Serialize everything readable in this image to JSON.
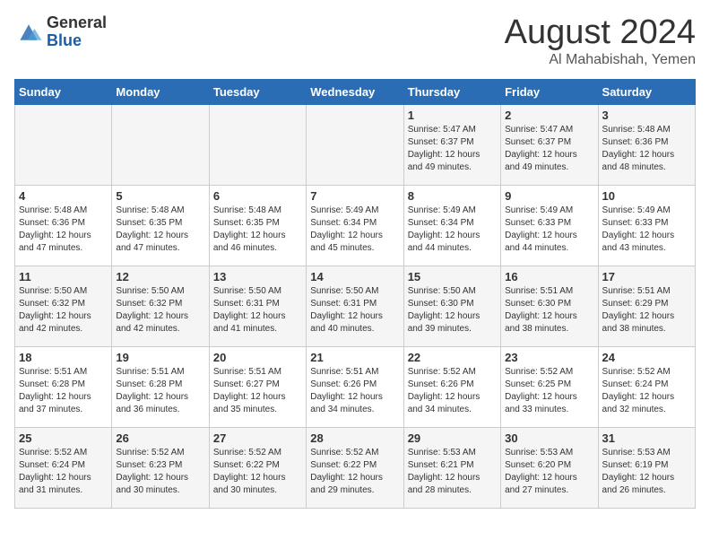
{
  "header": {
    "logo_general": "General",
    "logo_blue": "Blue",
    "main_title": "August 2024",
    "subtitle": "Al Mahabishah, Yemen"
  },
  "weekdays": [
    "Sunday",
    "Monday",
    "Tuesday",
    "Wednesday",
    "Thursday",
    "Friday",
    "Saturday"
  ],
  "weeks": [
    [
      {
        "day": "",
        "info": ""
      },
      {
        "day": "",
        "info": ""
      },
      {
        "day": "",
        "info": ""
      },
      {
        "day": "",
        "info": ""
      },
      {
        "day": "1",
        "info": "Sunrise: 5:47 AM\nSunset: 6:37 PM\nDaylight: 12 hours\nand 49 minutes."
      },
      {
        "day": "2",
        "info": "Sunrise: 5:47 AM\nSunset: 6:37 PM\nDaylight: 12 hours\nand 49 minutes."
      },
      {
        "day": "3",
        "info": "Sunrise: 5:48 AM\nSunset: 6:36 PM\nDaylight: 12 hours\nand 48 minutes."
      }
    ],
    [
      {
        "day": "4",
        "info": "Sunrise: 5:48 AM\nSunset: 6:36 PM\nDaylight: 12 hours\nand 47 minutes."
      },
      {
        "day": "5",
        "info": "Sunrise: 5:48 AM\nSunset: 6:35 PM\nDaylight: 12 hours\nand 47 minutes."
      },
      {
        "day": "6",
        "info": "Sunrise: 5:48 AM\nSunset: 6:35 PM\nDaylight: 12 hours\nand 46 minutes."
      },
      {
        "day": "7",
        "info": "Sunrise: 5:49 AM\nSunset: 6:34 PM\nDaylight: 12 hours\nand 45 minutes."
      },
      {
        "day": "8",
        "info": "Sunrise: 5:49 AM\nSunset: 6:34 PM\nDaylight: 12 hours\nand 44 minutes."
      },
      {
        "day": "9",
        "info": "Sunrise: 5:49 AM\nSunset: 6:33 PM\nDaylight: 12 hours\nand 44 minutes."
      },
      {
        "day": "10",
        "info": "Sunrise: 5:49 AM\nSunset: 6:33 PM\nDaylight: 12 hours\nand 43 minutes."
      }
    ],
    [
      {
        "day": "11",
        "info": "Sunrise: 5:50 AM\nSunset: 6:32 PM\nDaylight: 12 hours\nand 42 minutes."
      },
      {
        "day": "12",
        "info": "Sunrise: 5:50 AM\nSunset: 6:32 PM\nDaylight: 12 hours\nand 42 minutes."
      },
      {
        "day": "13",
        "info": "Sunrise: 5:50 AM\nSunset: 6:31 PM\nDaylight: 12 hours\nand 41 minutes."
      },
      {
        "day": "14",
        "info": "Sunrise: 5:50 AM\nSunset: 6:31 PM\nDaylight: 12 hours\nand 40 minutes."
      },
      {
        "day": "15",
        "info": "Sunrise: 5:50 AM\nSunset: 6:30 PM\nDaylight: 12 hours\nand 39 minutes."
      },
      {
        "day": "16",
        "info": "Sunrise: 5:51 AM\nSunset: 6:30 PM\nDaylight: 12 hours\nand 38 minutes."
      },
      {
        "day": "17",
        "info": "Sunrise: 5:51 AM\nSunset: 6:29 PM\nDaylight: 12 hours\nand 38 minutes."
      }
    ],
    [
      {
        "day": "18",
        "info": "Sunrise: 5:51 AM\nSunset: 6:28 PM\nDaylight: 12 hours\nand 37 minutes."
      },
      {
        "day": "19",
        "info": "Sunrise: 5:51 AM\nSunset: 6:28 PM\nDaylight: 12 hours\nand 36 minutes."
      },
      {
        "day": "20",
        "info": "Sunrise: 5:51 AM\nSunset: 6:27 PM\nDaylight: 12 hours\nand 35 minutes."
      },
      {
        "day": "21",
        "info": "Sunrise: 5:51 AM\nSunset: 6:26 PM\nDaylight: 12 hours\nand 34 minutes."
      },
      {
        "day": "22",
        "info": "Sunrise: 5:52 AM\nSunset: 6:26 PM\nDaylight: 12 hours\nand 34 minutes."
      },
      {
        "day": "23",
        "info": "Sunrise: 5:52 AM\nSunset: 6:25 PM\nDaylight: 12 hours\nand 33 minutes."
      },
      {
        "day": "24",
        "info": "Sunrise: 5:52 AM\nSunset: 6:24 PM\nDaylight: 12 hours\nand 32 minutes."
      }
    ],
    [
      {
        "day": "25",
        "info": "Sunrise: 5:52 AM\nSunset: 6:24 PM\nDaylight: 12 hours\nand 31 minutes."
      },
      {
        "day": "26",
        "info": "Sunrise: 5:52 AM\nSunset: 6:23 PM\nDaylight: 12 hours\nand 30 minutes."
      },
      {
        "day": "27",
        "info": "Sunrise: 5:52 AM\nSunset: 6:22 PM\nDaylight: 12 hours\nand 30 minutes."
      },
      {
        "day": "28",
        "info": "Sunrise: 5:52 AM\nSunset: 6:22 PM\nDaylight: 12 hours\nand 29 minutes."
      },
      {
        "day": "29",
        "info": "Sunrise: 5:53 AM\nSunset: 6:21 PM\nDaylight: 12 hours\nand 28 minutes."
      },
      {
        "day": "30",
        "info": "Sunrise: 5:53 AM\nSunset: 6:20 PM\nDaylight: 12 hours\nand 27 minutes."
      },
      {
        "day": "31",
        "info": "Sunrise: 5:53 AM\nSunset: 6:19 PM\nDaylight: 12 hours\nand 26 minutes."
      }
    ]
  ]
}
